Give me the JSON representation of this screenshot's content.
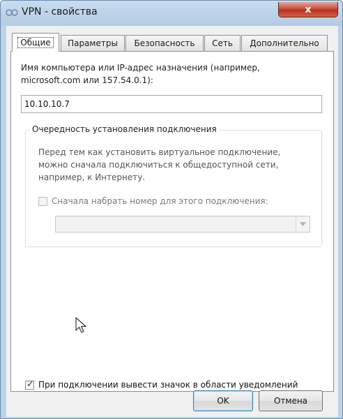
{
  "window": {
    "title": "VPN - свойства",
    "close_label": "x"
  },
  "tabs": [
    {
      "label": "Общие",
      "active": true
    },
    {
      "label": "Параметры",
      "active": false
    },
    {
      "label": "Безопасность",
      "active": false
    },
    {
      "label": "Сеть",
      "active": false
    },
    {
      "label": "Дополнительно",
      "active": false
    }
  ],
  "general": {
    "host_label_line1": "Имя компьютера или IP-адрес назначения (например,",
    "host_label_line2": "microsoft.com или 157.54.0.1):",
    "host_value": "10.10.10.7",
    "group_title": "Очередность установления подключения",
    "group_text_line1": "Перед тем как установить виртуальное подключение,",
    "group_text_line2": "можно сначала подключиться к общедоступной сети,",
    "group_text_line3": "например, к Интернету.",
    "dial_first_label": "Сначала набрать номер для этого подключения:",
    "dial_first_checked": false,
    "show_icon_label": "При подключении вывести значок в области уведомлений",
    "show_icon_checked": true
  },
  "buttons": {
    "ok": "OK",
    "cancel": "Отмена"
  },
  "icons": {
    "title": "network-connection-icon",
    "cursor": "mouse-pointer-icon"
  },
  "colors": {
    "frame": "#bcd2e8",
    "close": "#c9503d"
  }
}
